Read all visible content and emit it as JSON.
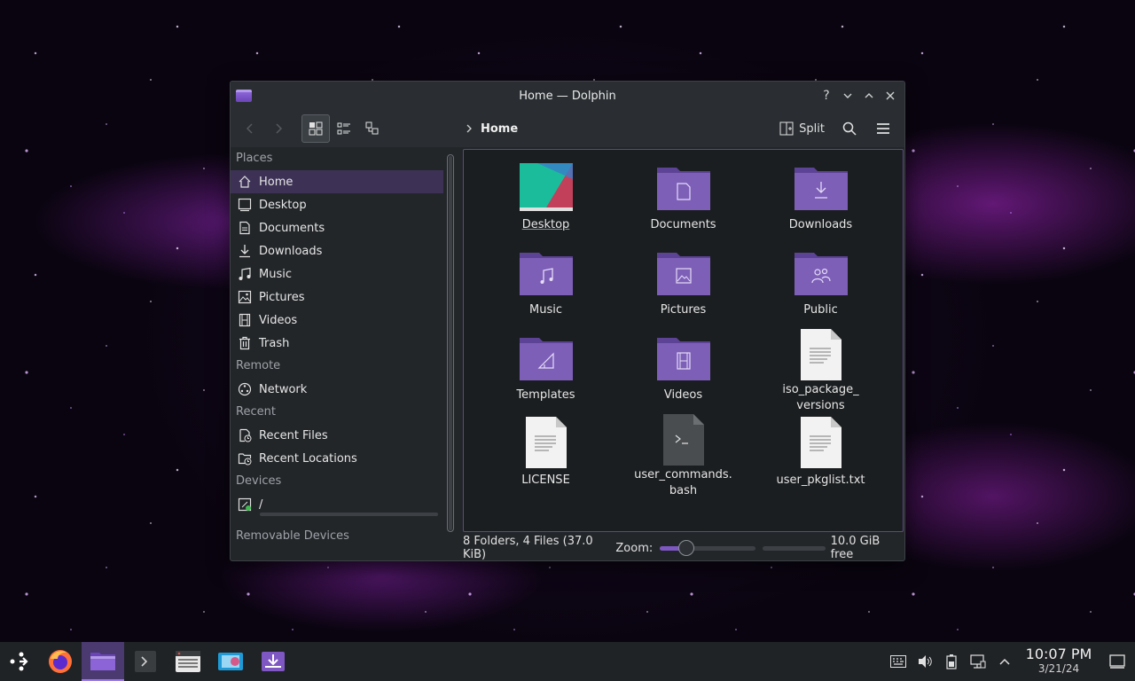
{
  "window": {
    "title": "Home — Dolphin",
    "controls": {
      "help": "?",
      "minimize": "⌄",
      "maximize": "⌃",
      "close": "✕"
    }
  },
  "toolbar": {
    "breadcrumb": "Home",
    "split_label": "Split"
  },
  "sidebar": {
    "sections": [
      {
        "label": "Places",
        "items": [
          "Home",
          "Desktop",
          "Documents",
          "Downloads",
          "Music",
          "Pictures",
          "Videos",
          "Trash"
        ]
      },
      {
        "label": "Remote",
        "items": [
          "Network"
        ]
      },
      {
        "label": "Recent",
        "items": [
          "Recent Files",
          "Recent Locations"
        ]
      },
      {
        "label": "Devices",
        "items": [
          "/"
        ]
      },
      {
        "label": "Removable Devices",
        "items": []
      }
    ],
    "selected": "Home"
  },
  "files": [
    {
      "name": "Desktop",
      "type": "desktop-folder"
    },
    {
      "name": "Documents",
      "type": "folder",
      "emblem": "document-icon"
    },
    {
      "name": "Downloads",
      "type": "folder",
      "emblem": "download-icon"
    },
    {
      "name": "Music",
      "type": "folder",
      "emblem": "music-note-icon"
    },
    {
      "name": "Pictures",
      "type": "folder",
      "emblem": "image-icon"
    },
    {
      "name": "Public",
      "type": "folder",
      "emblem": "users-icon"
    },
    {
      "name": "Templates",
      "type": "folder",
      "emblem": "ruler-icon"
    },
    {
      "name": "Videos",
      "type": "folder",
      "emblem": "film-icon"
    },
    {
      "name": "iso_package_\nversions",
      "type": "text-file"
    },
    {
      "name": "LICENSE",
      "type": "text-file"
    },
    {
      "name": "user_commands.\nbash",
      "type": "script-file"
    },
    {
      "name": "user_pkglist.txt",
      "type": "text-file"
    }
  ],
  "statusbar": {
    "summary": "8 Folders, 4 Files (37.0 KiB)",
    "zoom_label": "Zoom:",
    "zoom_level": 0.28,
    "free_space": "10.0 GiB free"
  },
  "taskbar": {
    "items": [
      "app-launcher-icon",
      "firefox-icon",
      "dolphin-icon",
      "terminal-icon",
      "system-monitor-icon",
      "screenshot-icon",
      "discover-icon"
    ],
    "active": "dolphin-icon"
  },
  "tray": {
    "time": "10:07 PM",
    "date": "3/21/24"
  },
  "colors": {
    "accent": "#7e57c2",
    "folder": "#7d5fb8",
    "window_bg": "#232629",
    "view_bg": "#1b1e20"
  }
}
